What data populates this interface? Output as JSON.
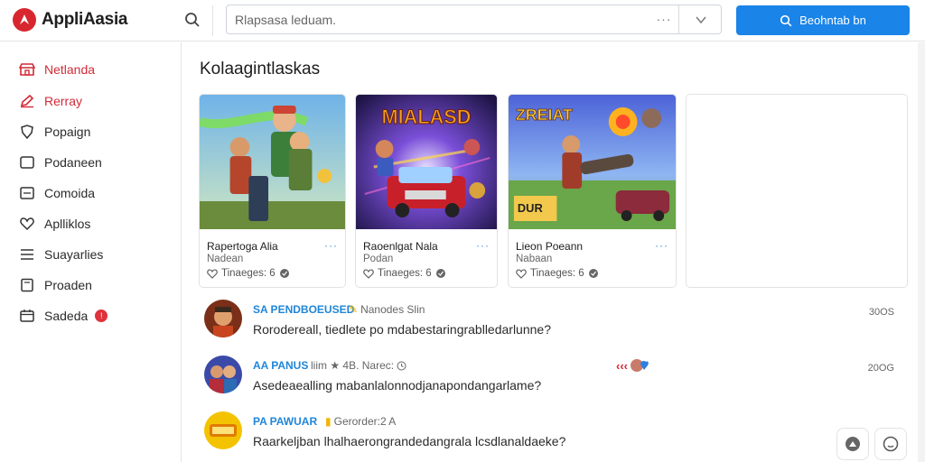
{
  "app": {
    "name": "AppliAasia"
  },
  "search": {
    "placeholder": "Rlapsasa leduam.",
    "more_label": "···",
    "submit_label": "Beohntab bn"
  },
  "colors": {
    "accent": "#1a84e8",
    "brand": "#d8262f",
    "link": "#1f86d8"
  },
  "sidebar": {
    "items": [
      {
        "label": "Netlanda",
        "icon": "store-icon",
        "active": true
      },
      {
        "label": "Rerray",
        "icon": "pencil-icon",
        "active": true
      },
      {
        "label": "Popaign",
        "icon": "shield-icon",
        "active": false
      },
      {
        "label": "Podaneen",
        "icon": "square-icon",
        "active": false
      },
      {
        "label": "Comoida",
        "icon": "window-icon",
        "active": false
      },
      {
        "label": "Aplliklos",
        "icon": "heart-icon",
        "active": false
      },
      {
        "label": "Suayarlies",
        "icon": "list-icon",
        "active": false
      },
      {
        "label": "Proaden",
        "icon": "doc-icon",
        "active": false
      },
      {
        "label": "Sadeda",
        "icon": "calendar-icon",
        "active": false,
        "badge": "!"
      }
    ]
  },
  "main": {
    "section_title": "Kolaagintlaskas",
    "cards": [
      {
        "title": "Rapertoga Alia",
        "subtitle": "Nadean",
        "meta": "Tinaeges: 6",
        "more": "···",
        "art_text": ""
      },
      {
        "title": "Raoenlgat Nala",
        "subtitle": "Podan",
        "meta": "Tinaeges: 6",
        "more": "···",
        "art_text": "MIALASD"
      },
      {
        "title": "Lieon Poeann",
        "subtitle": "Nabaan",
        "meta": "Tinaeges: 6",
        "more": "···",
        "art_text": "ZREIAT",
        "art_badge": "DUR"
      }
    ],
    "feed": [
      {
        "handle": "SA PENDBOEUSED",
        "meta": "Nanodes Slin",
        "text": "Rorodereall, tiedlete po mdabestaringrablledarlunne?",
        "time": "30OS"
      },
      {
        "handle": "AA PANUS",
        "meta": "liim ★ 4B. Narec:",
        "text": "Asedeaealling mabanlalonnodjanapondangarlame?",
        "time": "20OG"
      },
      {
        "handle": "PA PAWUAR",
        "meta": "Gerorder:2 A",
        "text": "Raarkeljban lhalhaerongrandedangrala lcsdlanaldaeke?",
        "time": ""
      }
    ]
  }
}
